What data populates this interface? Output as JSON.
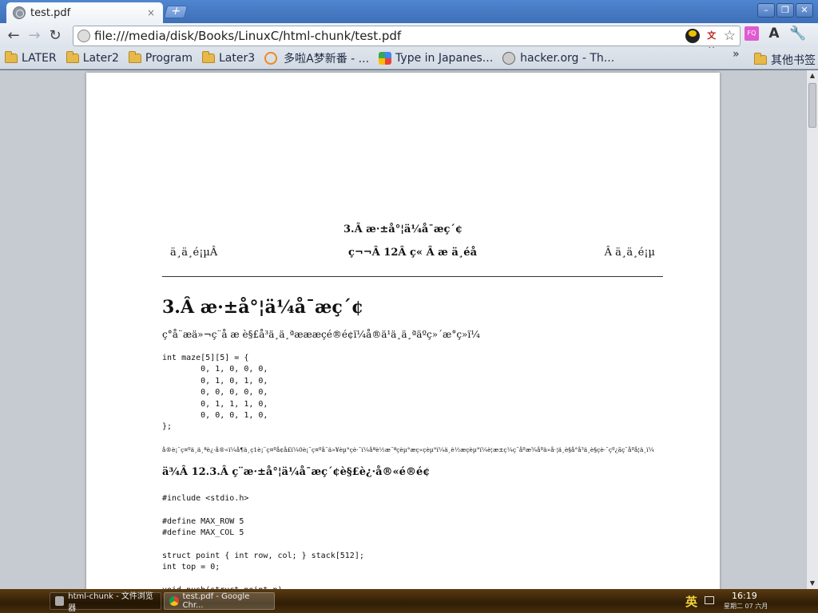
{
  "tab": {
    "title": "test.pdf",
    "close": "×",
    "new_tab": "+"
  },
  "window": {
    "minimize": "–",
    "restore": "❐",
    "close": "✕"
  },
  "toolbar": {
    "back": "←",
    "forward": "→",
    "reload": "↻",
    "url": "file:///media/disk/Books/LinuxC/html-chunk/test.pdf",
    "star": "☆",
    "font_size": "A",
    "wrench": "🔧",
    "fq": "FQ"
  },
  "bookmarks": {
    "items": [
      {
        "label": "LATER",
        "icon": "folder-icon"
      },
      {
        "label": "Later2",
        "icon": "folder-icon"
      },
      {
        "label": "Program",
        "icon": "folder-icon"
      },
      {
        "label": "Later3",
        "icon": "folder-icon"
      },
      {
        "label": "多啦A梦新番 - ...",
        "icon": "smiley-icon"
      },
      {
        "label": "Type in Japanes...",
        "icon": "google-icon"
      },
      {
        "label": "hacker.org - Th...",
        "icon": "globe-icon"
      }
    ],
    "more": "»",
    "other": "其他书签"
  },
  "pdf": {
    "header_title": "3.Â æ·±å°¦ä¼å¯æç´¢",
    "header_left": "ä¸ä¸é¡µÂ",
    "header_center": "ç¬¬Â 12Â ç« Â æ ä¸éå",
    "header_right": "Â ä¸ä¸é¡µ",
    "section_title": "3.Â æ·±å°¦ä¼å¯æç´¢",
    "intro": "ç°å¨æä»¬ç¨å æ è§£å³ä¸ä¸ªæææçé®é¢ï¼å®ä¹ä¸ä¸ªäºç»´æ°ç»ï¼",
    "code1": "int maze[5][5] = {\n        0, 1, 0, 0, 0,\n        0, 1, 0, 1, 0,\n        0, 0, 0, 0, 0,\n        0, 1, 1, 1, 0,\n        0, 0, 0, 1, 0,\n};",
    "note": "å®è¡¨ç¤ºä¸ä¸ªè¿·å®«ï¼å¶ä¸­ç1è¡¨ç¤ºå¢å£ï¼0è¡¨ç¤ºå¯ä»¥èµ°çè·¯ï¼åªè½æ¨ªçèµ°æç«çèµ°ï¼ä¸è½æçèµ°ï¼è¦æ±ç¼ç¨åºæ¾åºä»å·¦ä¸è§å°å³ä¸è§çè·¯çº¿ãç¨åºå¦ä¸ï¼",
    "example_title": "ä¾Â 12.3.Â ç¨æ·±å°¦ä¼å¯æç´¢è§£è¿·å®«é®é¢",
    "code2": "#include <stdio.h>\n\n#define MAX_ROW 5\n#define MAX_COL 5\n\nstruct point { int row, col; } stack[512];\nint top = 0;\n\nvoid push(struct point p)"
  },
  "taskbar": {
    "task1": "html-chunk - 文件浏览器",
    "task2": "test.pdf - Google Chr...",
    "ime": "英",
    "time": "16:19",
    "date": "星期二 07 六月"
  }
}
